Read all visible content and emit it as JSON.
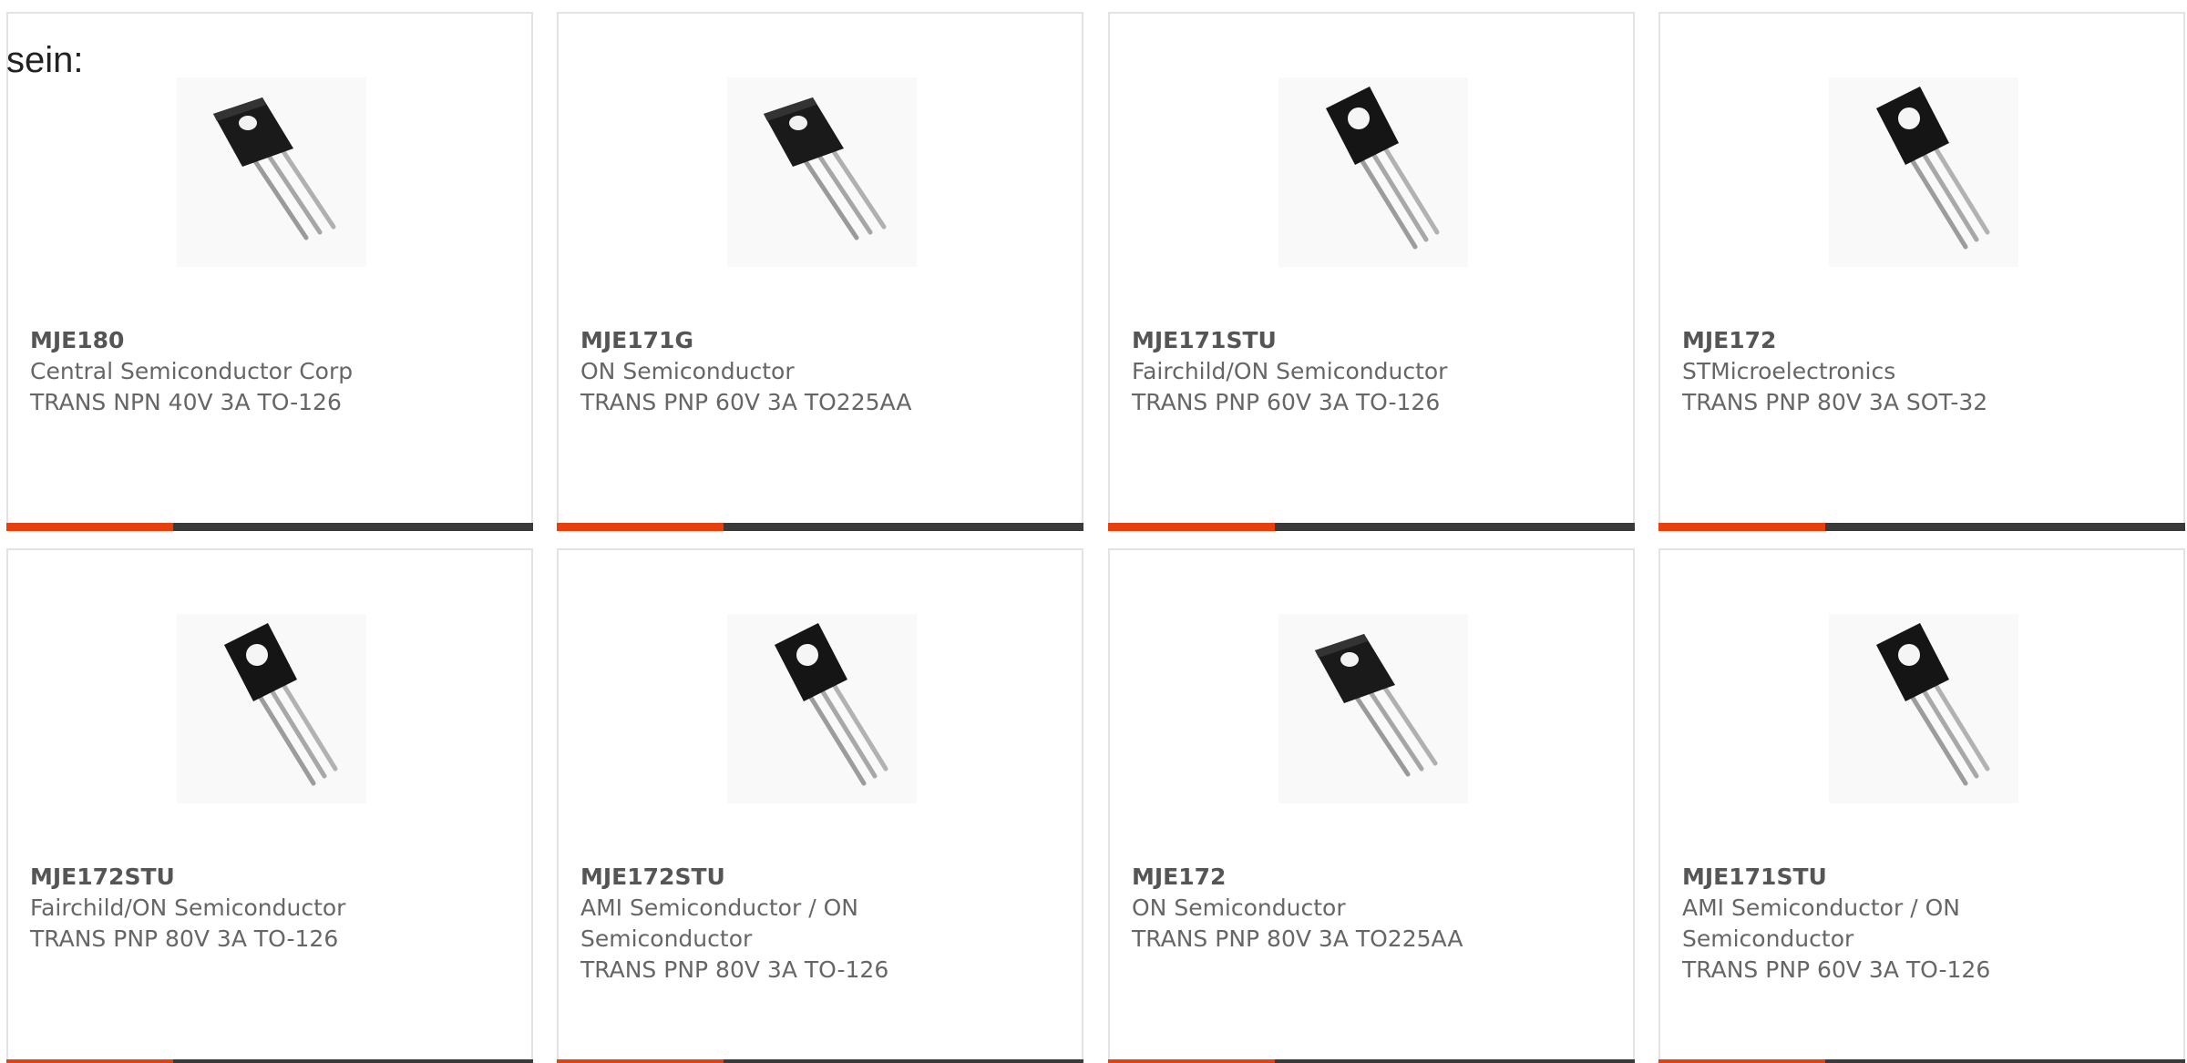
{
  "intro": {
    "text": "sein:"
  },
  "colors": {
    "accent": "#e8400c",
    "bar": "#3a3a3a",
    "border": "#e3e3e3",
    "text": "#666666"
  },
  "products": [
    {
      "part_number": "MJE180",
      "manufacturer": "Central Semiconductor Corp",
      "description": "TRANS NPN 40V 3A TO-126",
      "image_icon": "transistor-image"
    },
    {
      "part_number": "MJE171G",
      "manufacturer": "ON Semiconductor",
      "description": "TRANS PNP 60V 3A TO225AA",
      "image_icon": "transistor-image"
    },
    {
      "part_number": "MJE171STU",
      "manufacturer": "Fairchild/ON Semiconductor",
      "description": "TRANS PNP 60V 3A TO-126",
      "image_icon": "transistor-image"
    },
    {
      "part_number": "MJE172",
      "manufacturer": "STMicroelectronics",
      "description": "TRANS PNP 80V 3A SOT-32",
      "image_icon": "transistor-image"
    },
    {
      "part_number": "MJE172STU",
      "manufacturer": "Fairchild/ON Semiconductor",
      "description": "TRANS PNP 80V 3A TO-126",
      "image_icon": "transistor-image"
    },
    {
      "part_number": "MJE172STU",
      "manufacturer": "AMI Semiconductor / ON Semiconductor",
      "description": "TRANS PNP 80V 3A TO-126",
      "image_icon": "transistor-image"
    },
    {
      "part_number": "MJE172",
      "manufacturer": "ON Semiconductor",
      "description": "TRANS PNP 80V 3A TO225AA",
      "image_icon": "transistor-image"
    },
    {
      "part_number": "MJE171STU",
      "manufacturer": "AMI Semiconductor / ON Semiconductor",
      "description": "TRANS PNP 60V 3A TO-126",
      "image_icon": "transistor-image"
    }
  ]
}
